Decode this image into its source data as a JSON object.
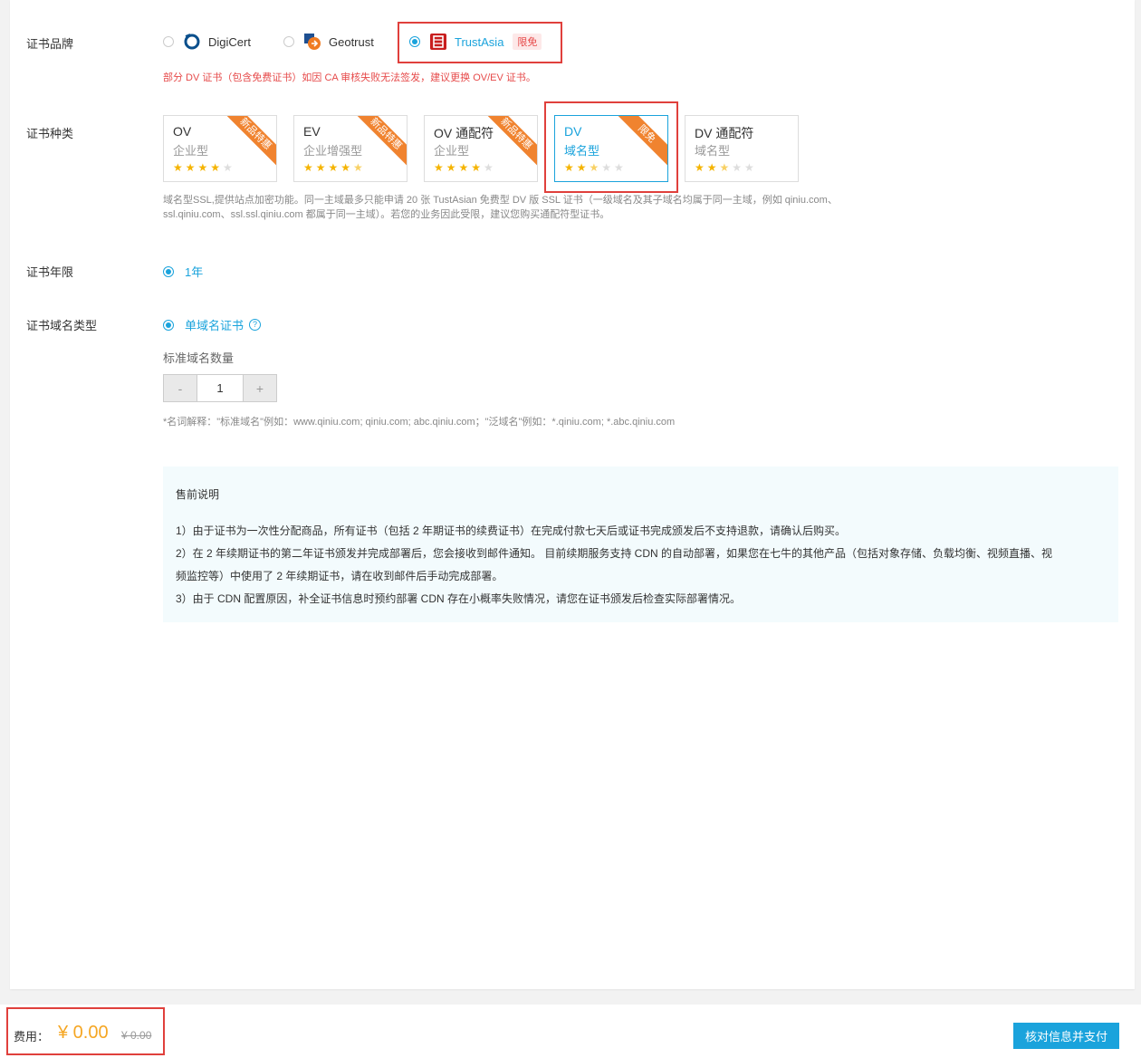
{
  "labels": {
    "brand": "证书品牌",
    "type": "证书种类",
    "years": "证书年限",
    "domain_type": "证书域名类型"
  },
  "brands": [
    {
      "name": "DigiCert",
      "selected": false,
      "icon": "digicert-logo-icon"
    },
    {
      "name": "Geotrust",
      "selected": false,
      "icon": "geotrust-logo-icon"
    },
    {
      "name": "TrustAsia",
      "selected": true,
      "icon": "trustasia-logo-icon",
      "tag": "限免"
    }
  ],
  "brand_warning": "部分 DV 证书（包含免费证书）如因 CA 审核失败无法签发，建议更换 OV/EV 证书。",
  "cert_types": [
    {
      "title": "OV",
      "subtitle": "企业型",
      "stars": 4,
      "ribbon": "新品特惠",
      "active": false
    },
    {
      "title": "EV",
      "subtitle": "企业增强型",
      "stars": 4.5,
      "ribbon": "新品特惠",
      "active": false
    },
    {
      "title": "OV 通配符",
      "subtitle": "企业型",
      "stars": 4,
      "ribbon": "新品特惠",
      "active": false
    },
    {
      "title": "DV",
      "subtitle": "域名型",
      "stars": 2.5,
      "ribbon": "限免",
      "active": true
    },
    {
      "title": "DV 通配符",
      "subtitle": "域名型",
      "stars": 2.5,
      "ribbon": "",
      "active": false
    }
  ],
  "type_note_line1": "域名型SSL,提供站点加密功能。同一主域最多只能申请 20 张 TustAsian 免费型 DV 版 SSL 证书（一级域名及其子域名均属于同一主域，例如 qiniu.com、",
  "type_note_line2": "ssl.qiniu.com、ssl.ssl.qiniu.com 都属于同一主域）。若您的业务因此受限，建议您购买通配符型证书。",
  "years_option": "1年",
  "domain_option": "单域名证书",
  "domain_count_label": "标准域名数量",
  "stepper": {
    "minus": "-",
    "value": "1",
    "plus": "+"
  },
  "domain_note": "*名词解释：\"标准域名\"例如：www.qiniu.com; qiniu.com; abc.qiniu.com；\"泛域名\"例如：*.qiniu.com; *.abc.qiniu.com",
  "presale": {
    "title": "售前说明",
    "items": [
      "1）由于证书为一次性分配商品，所有证书（包括 2 年期证书的续费证书）在完成付款七天后或证书完成颁发后不支持退款，请确认后购买。",
      "2）在 2 年续期证书的第二年证书颁发并完成部署后，您会接收到邮件通知。 目前续期服务支持 CDN 的自动部署，如果您在七牛的其他产品（包括对象存储、负载均衡、视频直播、视",
      "频监控等）中使用了 2 年续期证书，请在收到邮件后手动完成部署。",
      "3）由于 CDN 配置原因，补全证书信息时预约部署 CDN 存在小概率失败情况，请您在证书颁发后检查实际部署情况。"
    ]
  },
  "footer": {
    "fee_label": "费用：",
    "fee": "¥ 0.00",
    "fee_original": "¥ 0.00",
    "pay_button": "核对信息并支付"
  },
  "colors": {
    "accent": "#1aa3dc",
    "ribbon": "#f0832f",
    "price": "#f5a623",
    "highlight": "#e0403c"
  }
}
